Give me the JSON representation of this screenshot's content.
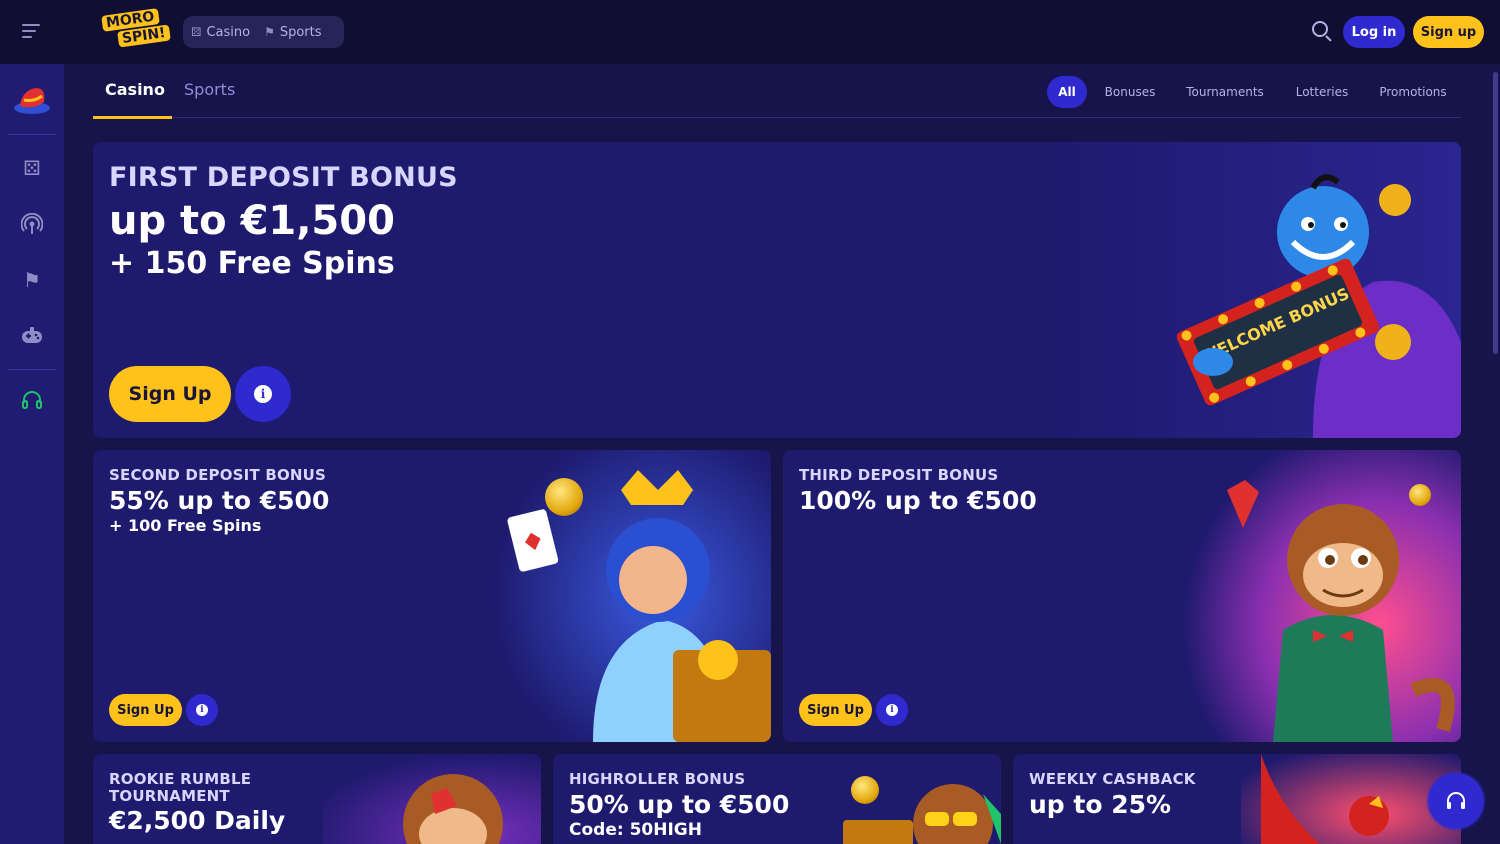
{
  "header": {
    "brand": {
      "line1": "MORO",
      "line2": "SPIN!"
    },
    "nav": [
      {
        "label": "Casino",
        "icon": "dice-icon"
      },
      {
        "label": "Sports",
        "icon": "flag-icon"
      }
    ],
    "login_label": "Log in",
    "signup_label": "Sign up"
  },
  "sidebar": {
    "items": [
      {
        "icon": "magic-hat-icon"
      },
      {
        "icon": "dice-icon"
      },
      {
        "icon": "live-broadcast-icon"
      },
      {
        "icon": "sports-flag-icon"
      },
      {
        "icon": "gamepad-icon"
      },
      {
        "icon": "headset-icon"
      }
    ]
  },
  "tabs": {
    "casino": "Casino",
    "sports": "Sports"
  },
  "filters": [
    "All",
    "Bonuses",
    "Tournaments",
    "Lotteries",
    "Promotions"
  ],
  "promos": {
    "first": {
      "kicker": "FIRST DEPOSIT BONUS",
      "headline": "up to €1,500",
      "sub": "+ 150 Free Spins",
      "cta": "Sign Up",
      "art_text": "WELCOME BONUS"
    },
    "second": {
      "kicker": "SECOND DEPOSIT BONUS",
      "headline": "55% up to €500",
      "sub": "+ 100 Free Spins",
      "cta": "Sign Up"
    },
    "third": {
      "kicker": "THIRD DEPOSIT BONUS",
      "headline": "100% up to €500",
      "cta": "Sign Up"
    },
    "rookie": {
      "kicker_line1": "ROOKIE RUMBLE",
      "kicker_line2": "TOURNAMENT",
      "headline": "€2,500 Daily"
    },
    "highroller": {
      "kicker": "HIGHROLLER BONUS",
      "headline": "50% up to €500",
      "sub": "Code: 50HIGH"
    },
    "cashback": {
      "kicker": "WEEKLY CASHBACK",
      "headline": "up to 25%"
    }
  },
  "colors": {
    "accent_yellow": "#ffc21a",
    "accent_blue": "#2f2ad0",
    "card_bg": "#1e1a6e",
    "page_bg": "#16144a"
  }
}
